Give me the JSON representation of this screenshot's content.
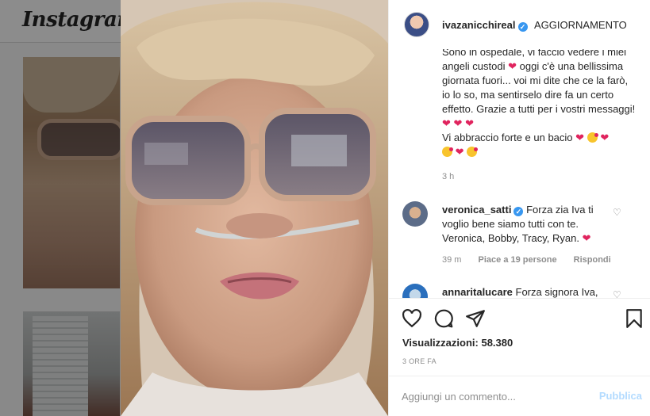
{
  "background": {
    "logo": "Instagram"
  },
  "post": {
    "author": {
      "username": "ivazanicchireal",
      "header_caption": "AGGIORNAMENTO"
    },
    "caption": {
      "text_1": "Sono in ospedale, vi faccio vedere i miei angeli custodi",
      "text_2": "oggi c'è una bellissima giornata fuori... voi mi dite che ce la farò, io lo so, ma sentirselo dire fa un certo effetto. Grazie a tutti per i vostri messaggi!",
      "text_3": "Vi abbraccio forte e un bacio",
      "time": "3 h"
    },
    "comments": [
      {
        "username": "veronica_satti",
        "text": "Forza zia Iva ti voglio bene siamo tutti con te. Veronica, Bobby, Tracy, Ryan.",
        "time": "39 m",
        "likes": "Piace a 19 persone",
        "reply": "Rispondi"
      },
      {
        "username": "annaritalucare",
        "text": "Forza signora Iva,"
      }
    ],
    "views_label": "Visualizzazioni:",
    "views_count": "58.380",
    "date": "3 ORE FA",
    "comment_placeholder": "Aggiungi un commento...",
    "publish_label": "Pubblica"
  },
  "icons": {
    "like": "heart-icon",
    "comment": "comment-icon",
    "share": "paper-plane-icon",
    "save": "bookmark-icon",
    "verified": "verified-badge-icon",
    "comment_like": "small-heart-icon"
  },
  "colors": {
    "heart": "#e0245e",
    "verified": "#3897f0",
    "publish_disabled": "#b3dbff",
    "muted_text": "#8e8e8e"
  }
}
